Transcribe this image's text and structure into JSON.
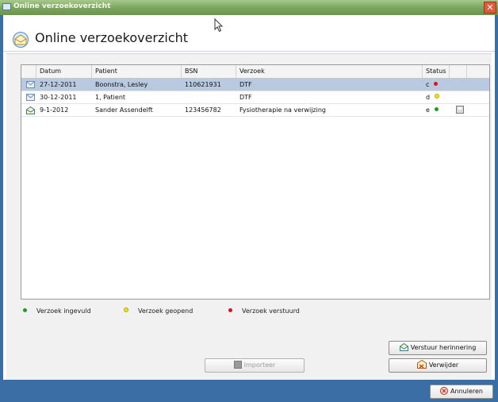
{
  "window": {
    "title": "Online verzoekoverzicht",
    "close_glyph": "✕"
  },
  "header": {
    "title": "Online verzoekoverzicht"
  },
  "table": {
    "columns": [
      "Datum",
      "Patient",
      "BSN",
      "Verzoek",
      "Status"
    ],
    "rows": [
      {
        "datum": "27-12-2011",
        "patient": "Boonstra, Lesley",
        "bsn": "110621931",
        "verzoek": "DTF",
        "status": "c",
        "status_color": "red",
        "selected": true
      },
      {
        "datum": "30-12-2011",
        "patient": "1, Patient",
        "bsn": "",
        "verzoek": "DTF",
        "status": "d",
        "status_color": "yellow",
        "selected": false
      },
      {
        "datum": "9-1-2012",
        "patient": "Sander Assendelft",
        "bsn": "123456782",
        "verzoek": "Fysiotherapie na verwijzing",
        "status": "e",
        "status_color": "green",
        "selected": false
      }
    ]
  },
  "legend": {
    "ingevuld": "Verzoek ingevuld",
    "geopend": "Verzoek geopend",
    "verstuurd": "Verzoek verstuurd"
  },
  "buttons": {
    "importeer": "Importeer",
    "verstuur_herinnering": "Verstuur herinnering",
    "verwijder": "Verwijder",
    "annuleren": "Annuleren"
  },
  "colors": {
    "green": "#1e9a2e",
    "yellow": "#f3e21a",
    "red": "#d8151b",
    "selection": "#b9c9e0"
  }
}
